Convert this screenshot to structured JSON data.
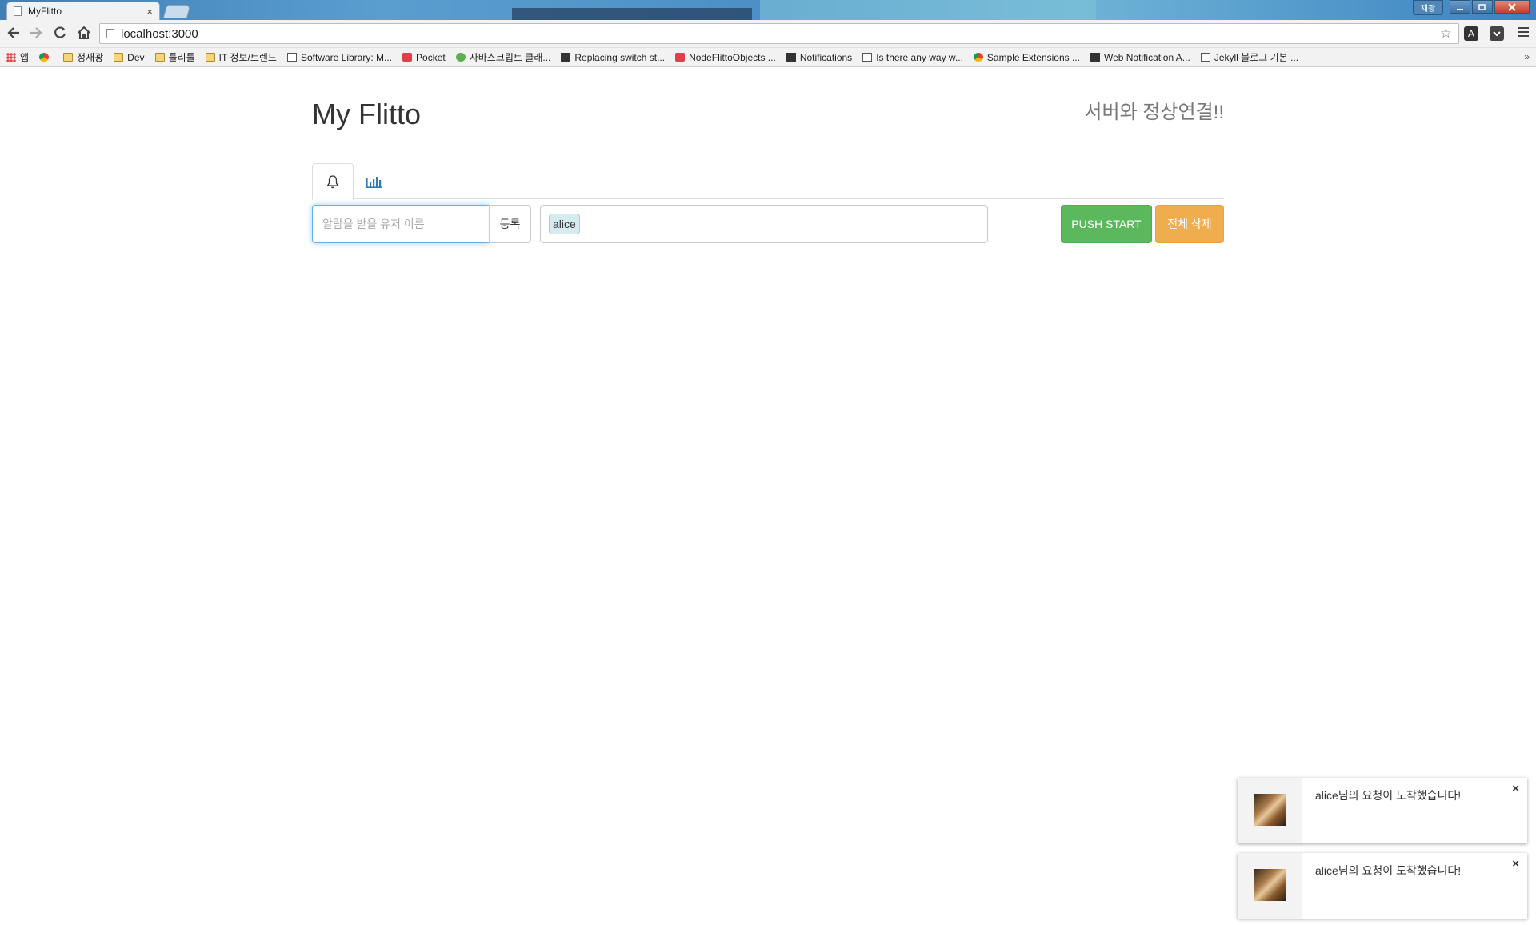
{
  "browser": {
    "tab_title": "MyFlitto",
    "tab_close": "×",
    "user_badge": "재광",
    "url": "localhost:3000",
    "bookmarks": [
      {
        "label": "앱",
        "icon": "apps-grid-icon"
      },
      {
        "label": "",
        "icon": "chrome-icon"
      },
      {
        "label": "정재광",
        "icon": "folder-icon"
      },
      {
        "label": "Dev",
        "icon": "folder-icon"
      },
      {
        "label": "툴리툴",
        "icon": "folder-icon"
      },
      {
        "label": "IT 정보/트렌드",
        "icon": "folder-icon"
      },
      {
        "label": "Software Library: M...",
        "icon": "library-icon"
      },
      {
        "label": "Pocket",
        "icon": "pocket-icon"
      },
      {
        "label": "자바스크립트 클래...",
        "icon": "avatar-icon"
      },
      {
        "label": "Replacing switch st...",
        "icon": "page-icon"
      },
      {
        "label": "NodeFlittoObjects ...",
        "icon": "paw-icon"
      },
      {
        "label": "Notifications",
        "icon": "dark-icon"
      },
      {
        "label": "Is there any way w...",
        "icon": "stack-icon"
      },
      {
        "label": "Sample Extensions ...",
        "icon": "chrome-icon"
      },
      {
        "label": "Web Notification A...",
        "icon": "cloud-icon"
      },
      {
        "label": "Jekyll 블로그 기본 ...",
        "icon": "code-icon"
      }
    ],
    "more": "»"
  },
  "header": {
    "title": "My Flitto",
    "status": "서버와 정상연결!!"
  },
  "tabs": [
    {
      "name": "notifications",
      "icon": "bell-icon"
    },
    {
      "name": "stats",
      "icon": "bar-chart-icon"
    }
  ],
  "form": {
    "input_placeholder": "알람을 받을 유저 이름",
    "input_value": "",
    "register_label": "등록",
    "tags": [
      "alice"
    ],
    "push_label": "PUSH START",
    "delete_label": "전체 삭제"
  },
  "notifications": [
    {
      "message": "alice님의 요청이 도착했습니다!",
      "close": "×"
    },
    {
      "message": "alice님의 요청이 도착했습니다!",
      "close": "×"
    }
  ],
  "colors": {
    "success": "#5cb85c",
    "warning": "#f0ad4e",
    "link": "#337ab7",
    "tag_bg": "#d6ebef"
  }
}
